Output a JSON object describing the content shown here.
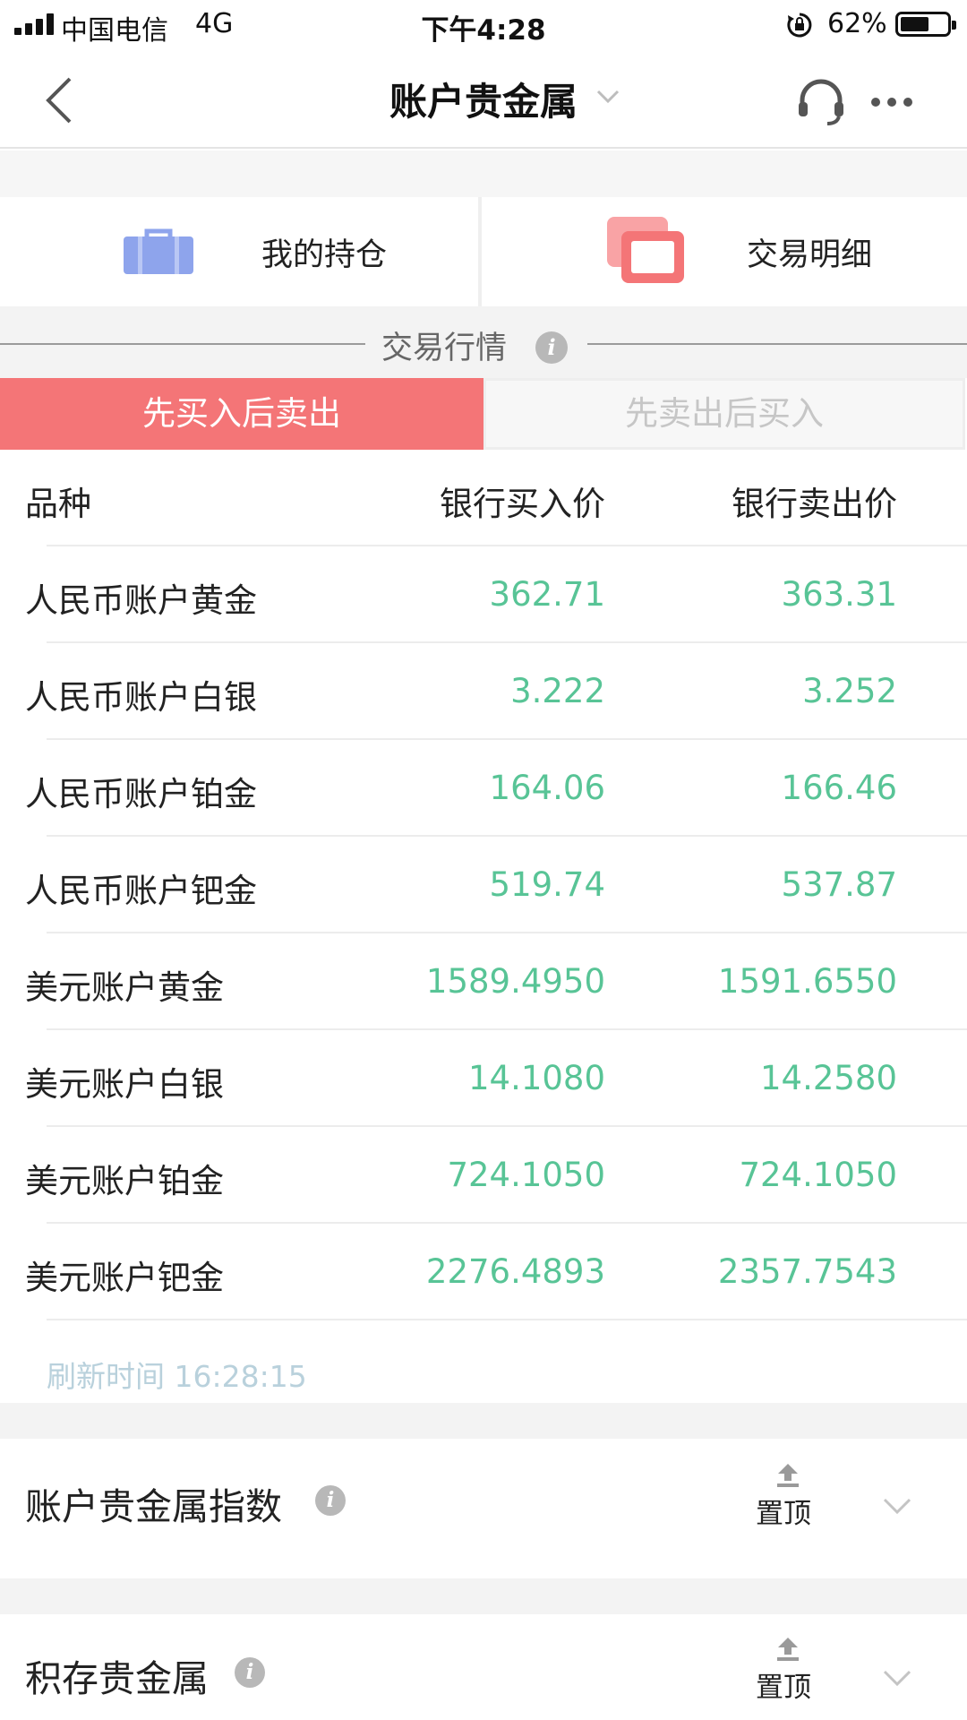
{
  "status_bar": {
    "carrier": "中国电信",
    "network": "4G",
    "time": "下午4:28",
    "battery": "62%",
    "battery_level": 0.62
  },
  "nav": {
    "title": "账户贵金属",
    "back_icon": "chevron-left-icon",
    "service_icon": "headset-icon",
    "more_icon": "more-dots-icon"
  },
  "quick_actions": [
    {
      "label": "我的持仓",
      "icon": "briefcase-icon",
      "color": "#8ea4ec"
    },
    {
      "label": "交易明细",
      "icon": "copy-icon",
      "color": "#f47577"
    }
  ],
  "market": {
    "section_title": "交易行情",
    "tabs": [
      {
        "label": "先买入后卖出",
        "active": true
      },
      {
        "label": "先卖出后买入",
        "active": false
      }
    ],
    "columns": [
      "品种",
      "银行买入价",
      "银行卖出价"
    ],
    "rows": [
      {
        "name": "人民币账户黄金",
        "buy": "362.71",
        "sell": "363.31"
      },
      {
        "name": "人民币账户白银",
        "buy": "3.222",
        "sell": "3.252"
      },
      {
        "name": "人民币账户铂金",
        "buy": "164.06",
        "sell": "166.46"
      },
      {
        "name": "人民币账户钯金",
        "buy": "519.74",
        "sell": "537.87"
      },
      {
        "name": "美元账户黄金",
        "buy": "1589.4950",
        "sell": "1591.6550"
      },
      {
        "name": "美元账户白银",
        "buy": "14.1080",
        "sell": "14.2580"
      },
      {
        "name": "美元账户铂金",
        "buy": "724.1050",
        "sell": "724.1050"
      },
      {
        "name": "美元账户钯金",
        "buy": "2276.4893",
        "sell": "2357.7543"
      }
    ],
    "refresh_time": "刷新时间 16:28:15",
    "price_color": "#58c496",
    "accent_color": "#f47577"
  },
  "sections": [
    {
      "title": "账户贵金属指数",
      "pin_label": "置顶"
    },
    {
      "title": "积存贵金属",
      "pin_label": "置顶"
    }
  ]
}
